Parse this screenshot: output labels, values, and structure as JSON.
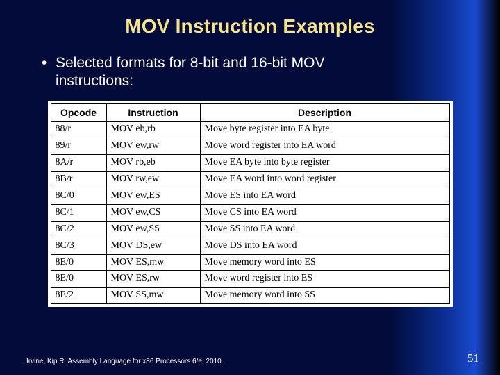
{
  "title": "MOV Instruction Examples",
  "bullet": {
    "line1": "Selected formats for 8-bit and 16-bit MOV",
    "line2": "instructions:"
  },
  "table": {
    "headers": {
      "opcode": "Opcode",
      "instruction": "Instruction",
      "description": "Description"
    },
    "rows": [
      {
        "opcode": "88/r",
        "instruction": "MOV eb,rb",
        "description": "Move byte register into EA byte"
      },
      {
        "opcode": "89/r",
        "instruction": "MOV ew,rw",
        "description": "Move word register into EA word"
      },
      {
        "opcode": "8A/r",
        "instruction": "MOV rb,eb",
        "description": "Move EA byte into byte register"
      },
      {
        "opcode": "8B/r",
        "instruction": "MOV rw,ew",
        "description": "Move EA word into word register"
      },
      {
        "opcode": "8C/0",
        "instruction": "MOV ew,ES",
        "description": "Move ES into EA word"
      },
      {
        "opcode": "8C/1",
        "instruction": "MOV ew,CS",
        "description": "Move CS into EA word"
      },
      {
        "opcode": "8C/2",
        "instruction": "MOV ew,SS",
        "description": "Move SS into EA word"
      },
      {
        "opcode": "8C/3",
        "instruction": "MOV DS,ew",
        "description": "Move DS into EA word"
      },
      {
        "opcode": "8E/0",
        "instruction": "MOV ES,mw",
        "description": "Move memory word into ES"
      },
      {
        "opcode": "8E/0",
        "instruction": "MOV ES,rw",
        "description": "Move word register into ES"
      },
      {
        "opcode": "8E/2",
        "instruction": "MOV SS,mw",
        "description": "Move memory word into SS"
      }
    ]
  },
  "footer": {
    "citation": "Irvine, Kip R. Assembly Language for x86 Processors 6/e, 2010.",
    "page": "51"
  }
}
